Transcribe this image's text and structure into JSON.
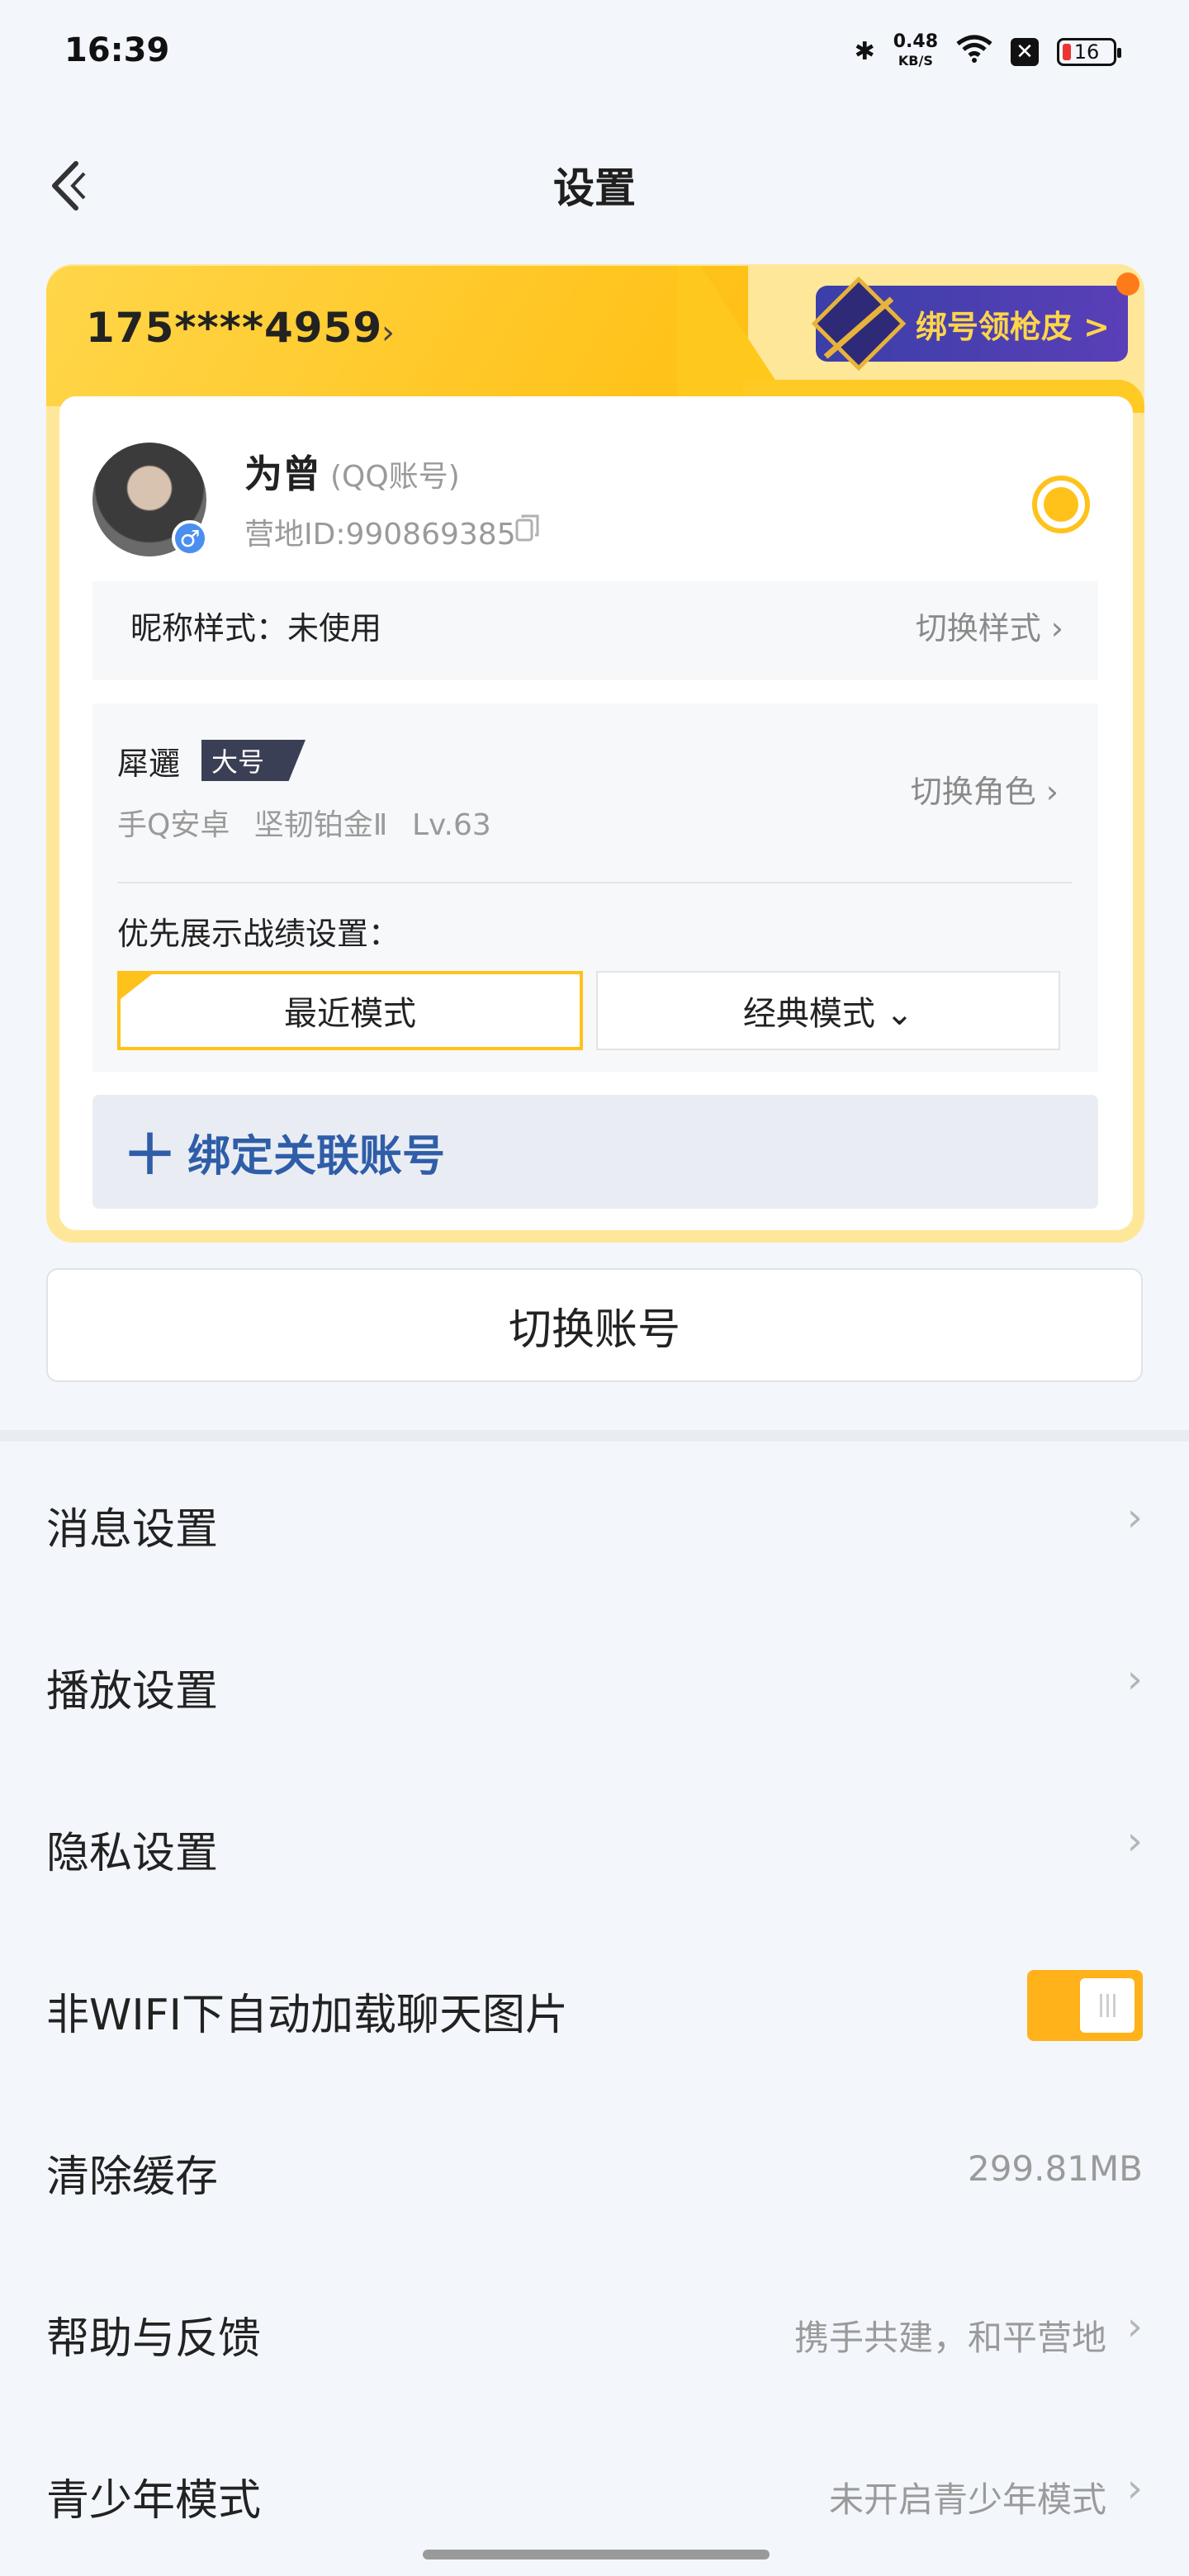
{
  "status_bar": {
    "time": "16:39",
    "net_speed_value": "0.48",
    "net_speed_unit": "KB/S",
    "battery": "16",
    "icons": [
      "bluetooth-icon",
      "wifi-icon",
      "sim-off-icon",
      "battery-icon"
    ]
  },
  "header": {
    "title": "设置"
  },
  "account_card": {
    "phone": "175****4959",
    "promo_label": "绑号领枪皮 >",
    "user": {
      "name": "为曾",
      "account_type": "(QQ账号)",
      "camp_id": "营地ID:990869385"
    },
    "nickname": {
      "label": "昵称样式：未使用",
      "switch": "切换样式 ›"
    },
    "role": {
      "name": "犀邐",
      "badge": "大号",
      "info": "手Q安卓 坚韧铂金Ⅱ Lv.63",
      "switch": "切换角色 ›"
    },
    "display_pref": {
      "label": "优先展示战绩设置：",
      "recent": "最近模式",
      "classic": "经典模式 ⌄"
    },
    "bind_label": "绑定关联账号"
  },
  "switch_account": "切换账号",
  "settings": [
    {
      "label": "消息设置",
      "value": "",
      "chevron": "›"
    },
    {
      "label": "播放设置",
      "value": "",
      "chevron": "›"
    },
    {
      "label": "隐私设置",
      "value": "",
      "chevron": "›"
    },
    {
      "label": "非WIFI下自动加载聊天图片",
      "toggle_on": true
    },
    {
      "label": "清除缓存",
      "value": "299.81MB"
    },
    {
      "label": "帮助与反馈",
      "value": "携手共建，和平营地",
      "chevron": "›"
    },
    {
      "label": "青少年模式",
      "value": "未开启青少年模式",
      "chevron": "›"
    }
  ],
  "colors": {
    "accent": "#ffc21a",
    "link_blue": "#2f5da8",
    "background": "#f3f6fb"
  }
}
